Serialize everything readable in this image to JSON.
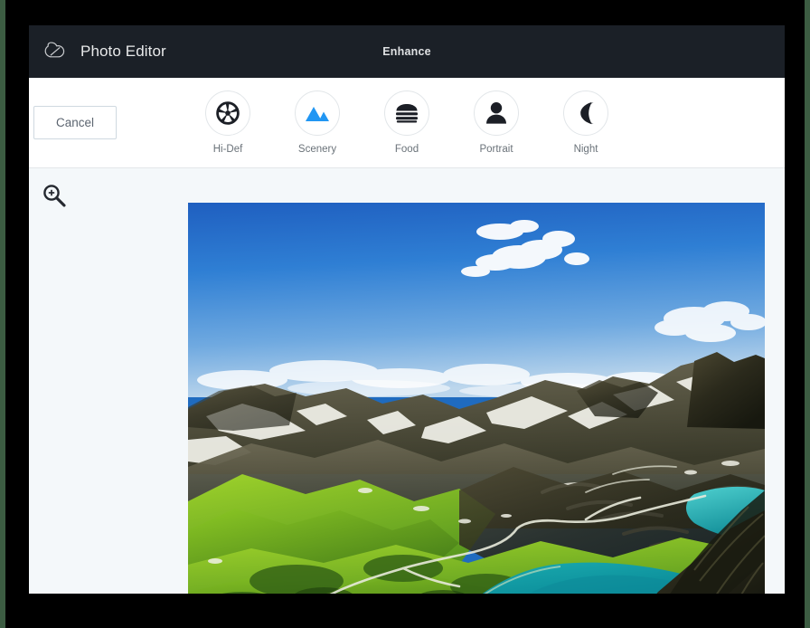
{
  "window": {
    "titlebar": {
      "logo_icon": "creative-cloud-logo",
      "app_name": "Photo Editor",
      "screen_title": "Enhance",
      "background_color": "#1b2027",
      "text_color": "#e8e9ea"
    },
    "toolbar": {
      "cancel_label": "Cancel",
      "background_color": "#ffffff",
      "filters": [
        {
          "id": "hi-def",
          "label": "Hi-Def",
          "icon": "aperture-icon",
          "icon_color": "#1c1f26"
        },
        {
          "id": "scenery",
          "label": "Scenery",
          "icon": "mountains-icon",
          "icon_color": "#2196f3"
        },
        {
          "id": "food",
          "label": "Food",
          "icon": "burger-icon",
          "icon_color": "#1c1f26"
        },
        {
          "id": "portrait",
          "label": "Portrait",
          "icon": "person-icon",
          "icon_color": "#1c1f26"
        },
        {
          "id": "night",
          "label": "Night",
          "icon": "moon-icon",
          "icon_color": "#1c1f26"
        }
      ]
    },
    "content": {
      "background_color": "#f4f8fa",
      "zoom_tool_icon": "magnifier-plus-icon",
      "photo": {
        "alt": "Aerial view of alpine valley with turquoise mountain lakes, green meadows and snow-capped peaks under a blue sky with white clouds",
        "sky_color": "#2f7fd4",
        "lake_color": "#1aa3a8",
        "meadow_color": "#7cc024"
      }
    }
  }
}
